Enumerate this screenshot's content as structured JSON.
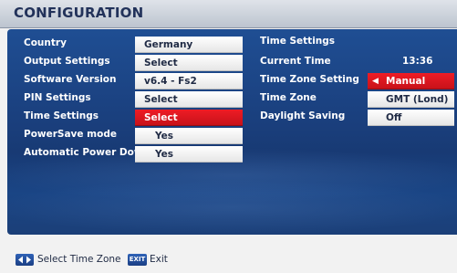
{
  "header": {
    "title": "CONFIGURATION"
  },
  "menu": {
    "items": [
      {
        "label": "Country",
        "value": "Germany"
      },
      {
        "label": "Output Settings",
        "value": "Select"
      },
      {
        "label": "Software Version",
        "value": "v6.4 - Fs2"
      },
      {
        "label": "PIN Settings",
        "value": "Select"
      },
      {
        "label": "Time Settings",
        "value": "Select"
      },
      {
        "label": "PowerSave mode",
        "value": "Yes"
      },
      {
        "label": "Automatic Power Down",
        "value": "Yes"
      }
    ],
    "selected_index": 4
  },
  "time_settings": {
    "heading": "Time Settings",
    "rows": [
      {
        "label": "Current Time",
        "value": "13:36"
      },
      {
        "label": "Time Zone Setting",
        "value": "Manual"
      },
      {
        "label": "Time Zone",
        "value": "GMT (Lond)"
      },
      {
        "label": "Daylight Saving",
        "value": "Off"
      }
    ]
  },
  "footer": {
    "nav_key_icon": "left-right-arrows",
    "nav_hint": "Select Time Zone",
    "exit_key_label": "EXIT",
    "exit_hint": "Exit"
  },
  "colors": {
    "panel": "#1b4585",
    "highlight": "#e31b23",
    "title": "#22325a"
  }
}
